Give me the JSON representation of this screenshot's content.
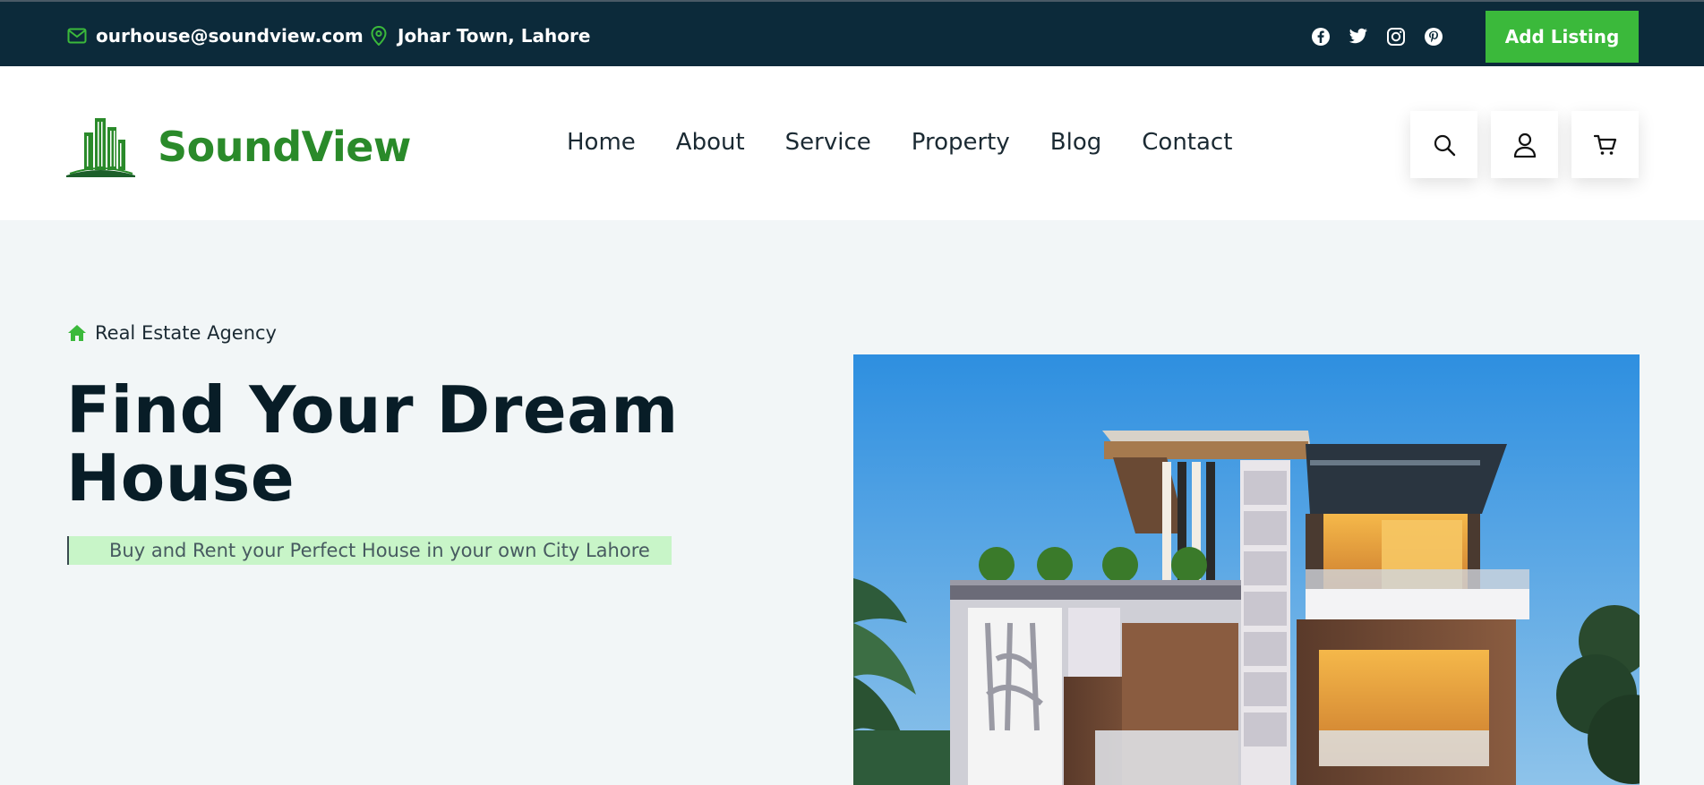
{
  "topbar": {
    "email": "ourhouse@soundview.com",
    "location": "Johar Town, Lahore",
    "socials": [
      "facebook-icon",
      "twitter-icon",
      "instagram-icon",
      "pinterest-icon"
    ],
    "add_listing_label": "Add Listing",
    "accent": "#3bb93b",
    "background": "#0c2a3a"
  },
  "header": {
    "logo_text": "SoundView",
    "logo_color": "#2a8a2a",
    "nav": [
      {
        "label": "Home"
      },
      {
        "label": "About"
      },
      {
        "label": "Service"
      },
      {
        "label": "Property"
      },
      {
        "label": "Blog"
      },
      {
        "label": "Contact"
      }
    ],
    "icons": [
      "search-icon",
      "user-icon",
      "cart-icon"
    ]
  },
  "hero": {
    "tagline": "Real Estate Agency",
    "title": "Find Your Dream House",
    "subtitle": "Buy and Rent your Perfect House in your own City Lahore",
    "image_alt": "modern house exterior"
  }
}
